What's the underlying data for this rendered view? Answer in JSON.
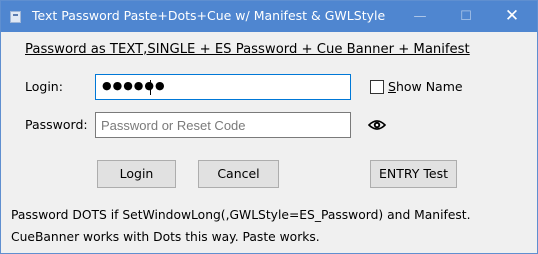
{
  "window": {
    "title": "Text Password Paste+Dots+Cue w/ Manifest & GWLStyle",
    "controls": {
      "minimize": "—",
      "maximize": "☐",
      "close": "✕"
    }
  },
  "heading": "Password as TEXT,SINGLE + ES Password + Cue Banner + Manifest",
  "login": {
    "label": "Login:",
    "value_masked": "●●●●●●"
  },
  "password": {
    "label": "Password:",
    "placeholder": "Password or Reset Code",
    "value": ""
  },
  "show_name": {
    "label_underlined": "S",
    "label_rest": "how Name",
    "checked": false
  },
  "buttons": {
    "login": "Login",
    "cancel": "Cancel",
    "entry_test": "ENTRY Test"
  },
  "footer": {
    "line1": "Password DOTS if SetWindowLong(,GWLStyle=ES_Password) and Manifest.",
    "line2": "CueBanner works with Dots this way. Paste works."
  },
  "icons": {
    "app": "app-icon",
    "reveal": "eye-icon"
  },
  "colors": {
    "titlebar": "#4f86d0",
    "focus_border": "#0078d7",
    "button_face": "#e1e1e1",
    "dialog_bg": "#f0f0f0"
  }
}
